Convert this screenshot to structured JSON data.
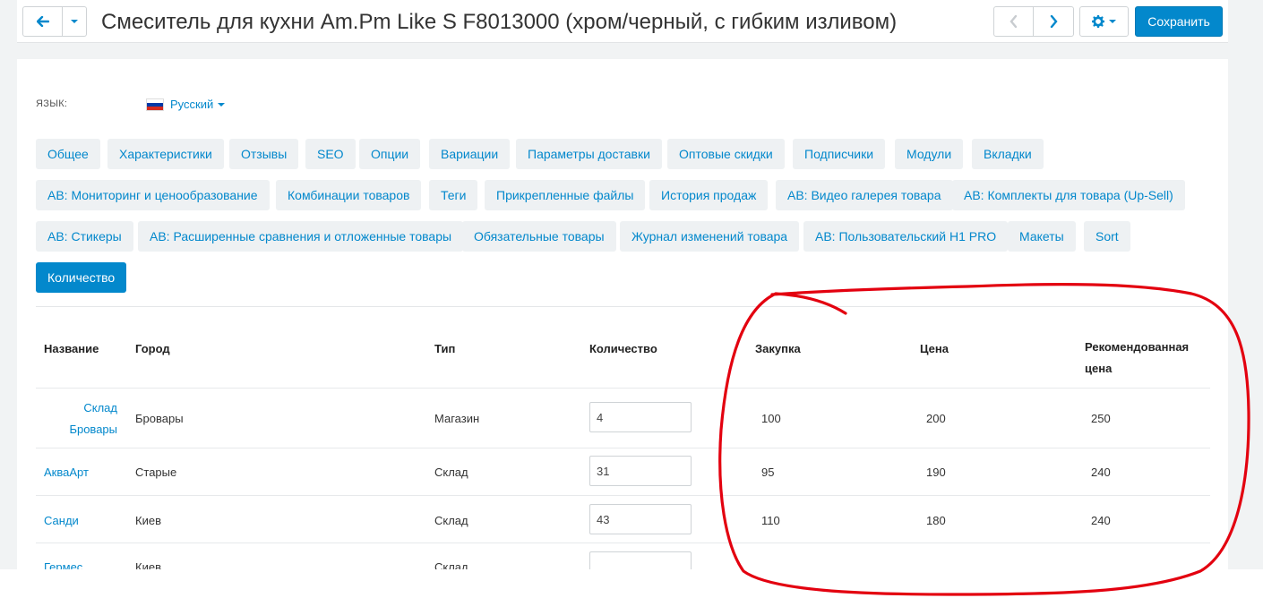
{
  "header": {
    "title": "Смеситель для кухни Am.Pm Like S F8013000 (хром/черный, с гибким изливом)",
    "back_icon": "arrow-left-icon",
    "dropdown_icon": "caret-down-icon",
    "prev_icon": "chevron-left-icon",
    "next_icon": "chevron-right-icon",
    "settings_icon": "gear-icon",
    "save_label": "Сохранить"
  },
  "language": {
    "label": "ЯЗЫК:",
    "selected": "Русский"
  },
  "tabs": [
    {
      "label": "Общее"
    },
    {
      "label": "Характеристики"
    },
    {
      "label": "Отзывы"
    },
    {
      "label": "SEO"
    },
    {
      "label": "Опции"
    },
    {
      "label": "Вариации"
    },
    {
      "label": "Параметры доставки"
    },
    {
      "label": "Оптовые скидки"
    },
    {
      "label": "Подписчики"
    },
    {
      "label": "Модули"
    },
    {
      "label": "Вкладки"
    },
    {
      "label": "AB: Мониторинг и ценообразование"
    },
    {
      "label": "Комбинации товаров"
    },
    {
      "label": "Теги"
    },
    {
      "label": "Прикрепленные файлы"
    },
    {
      "label": "История продаж"
    },
    {
      "label": "AB: Видео галерея товара"
    },
    {
      "label": "AB: Комплекты для товара (Up-Sell)"
    },
    {
      "label": "AB: Стикеры"
    },
    {
      "label": "AB: Расширенные сравнения и отложенные товары"
    },
    {
      "label": "Обязательные товары"
    },
    {
      "label": "Журнал изменений товара"
    },
    {
      "label": "AB: Пользовательский H1 PRO"
    },
    {
      "label": "Макеты"
    },
    {
      "label": "Sort"
    },
    {
      "label": "Количество"
    }
  ],
  "active_tab": "Количество",
  "table": {
    "columns": [
      "Название",
      "Город",
      "Тип",
      "Количество",
      "Закупка",
      "Цена",
      "Рекомендованная цена"
    ],
    "rows": [
      {
        "name": "Склад Бровары",
        "city": "Бровары",
        "type": "Магазин",
        "qty": "4",
        "purchase": "100",
        "price": "200",
        "recommended": "250"
      },
      {
        "name": "АкваАрт",
        "city": "Старые",
        "type": "Склад",
        "qty": "31",
        "purchase": "95",
        "price": "190",
        "recommended": "240"
      },
      {
        "name": "Санди",
        "city": "Киев",
        "type": "Склад",
        "qty": "43",
        "purchase": "110",
        "price": "180",
        "recommended": "240"
      },
      {
        "name": "Гермес",
        "city": "Киев",
        "type": "Склад",
        "qty": "",
        "purchase": "",
        "price": "",
        "recommended": ""
      }
    ]
  },
  "colors": {
    "accent": "#0388cc",
    "tab_bg": "#eef1f3",
    "annotation": "#e3000f"
  }
}
